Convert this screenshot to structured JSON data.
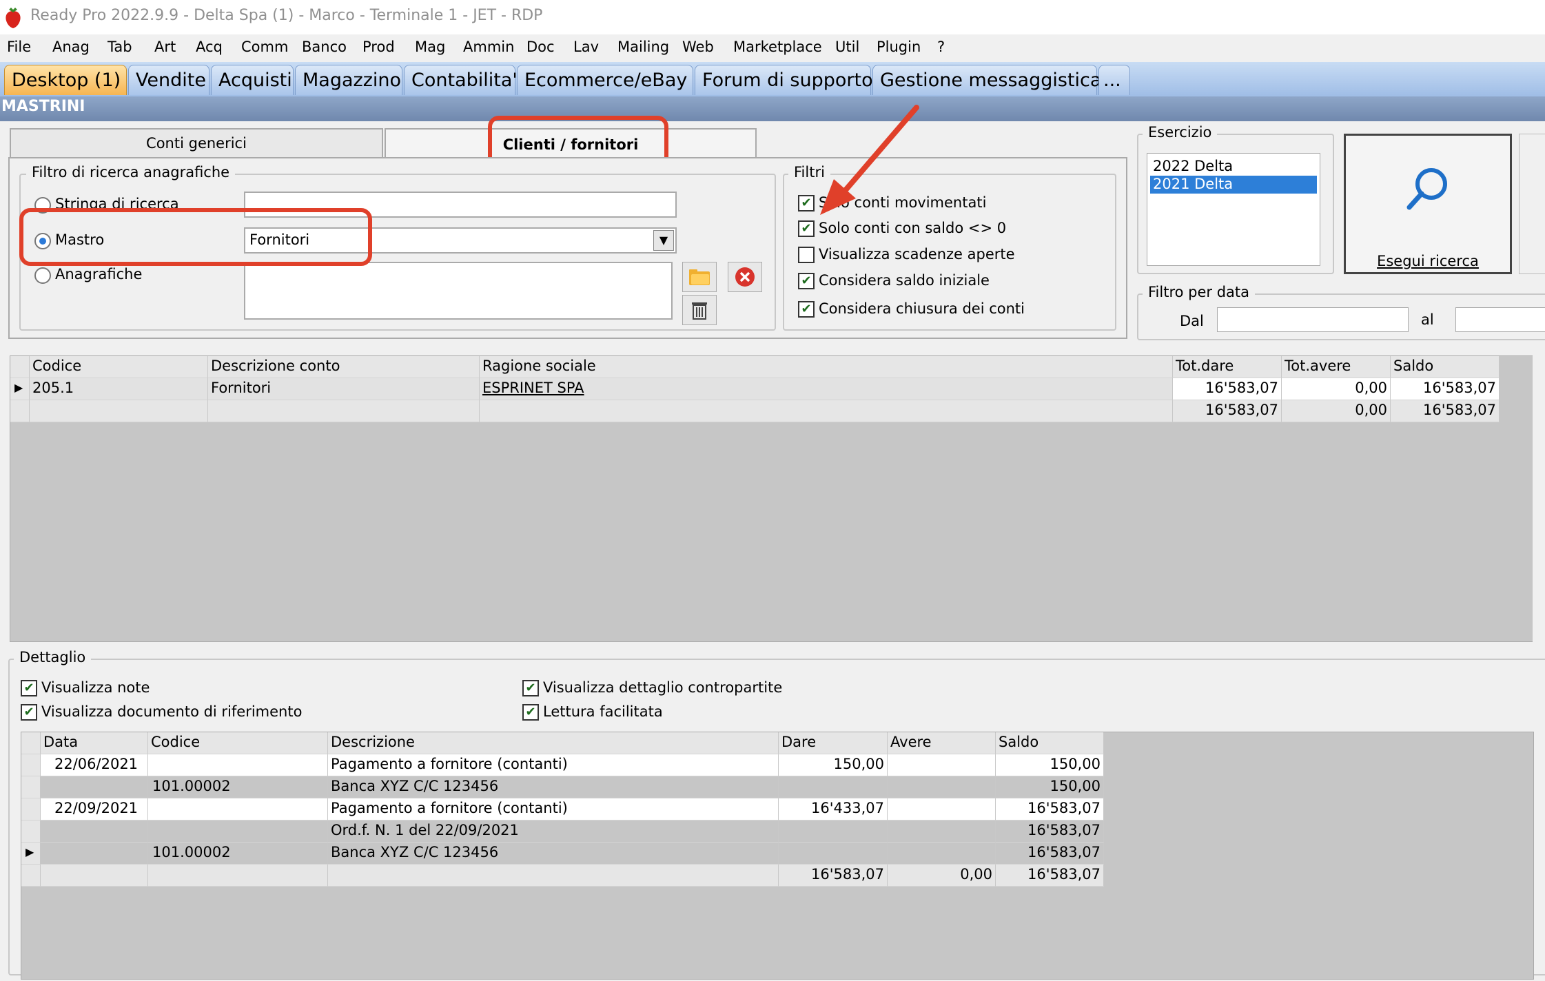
{
  "window": {
    "title": "Ready Pro 2022.9.9 - Delta Spa (1) - Marco - Terminale 1 - JET - RDP"
  },
  "menu": [
    "File",
    "Anag",
    "Tab",
    "Art",
    "Acq",
    "Comm",
    "Banco",
    "Prod",
    "Mag",
    "Ammin",
    "Doc",
    "Lav",
    "Mailing",
    "Web",
    "Marketplace",
    "Util",
    "Plugin",
    "?"
  ],
  "app_tabs": [
    "Desktop (1)",
    "Vendite",
    "Acquisti",
    "Magazzino",
    "Contabilita'",
    "Ecommerce/eBay",
    "Forum di supporto",
    "Gestione messaggistica",
    "..."
  ],
  "section_title": "MASTRINI",
  "inner_tabs": {
    "tab1": "Conti generici",
    "tab2": "Clienti / fornitori"
  },
  "filtro": {
    "legend": "Filtro di ricerca anagrafiche",
    "opt1": "Stringa di ricerca",
    "opt2": "Mastro",
    "opt3": "Anagrafiche",
    "mastro_value": "Fornitori"
  },
  "filtri": {
    "legend": "Filtri",
    "items": [
      "Solo conti movimentati",
      "Solo conti con saldo <> 0",
      "Visualizza scadenze aperte",
      "Considera saldo iniziale",
      "Considera chiusura dei conti"
    ],
    "checked": [
      true,
      true,
      false,
      true,
      true
    ]
  },
  "esercizio": {
    "legend": "Esercizio",
    "items": [
      "2022 Delta",
      "2021 Delta"
    ],
    "selected": 1
  },
  "search_button": "Esegui ricerca",
  "filtro_data": {
    "legend": "Filtro per data",
    "dal": "Dal",
    "al": "al"
  },
  "top_grid": {
    "headers": [
      "Codice",
      "Descrizione conto",
      "Ragione sociale",
      "Tot.dare",
      "Tot.avere",
      "Saldo"
    ],
    "rows": [
      [
        "205.1",
        "Fornitori",
        "ESPRINET SPA",
        "16'583,07",
        "0,00",
        "16'583,07"
      ],
      [
        "",
        "",
        "",
        "16'583,07",
        "0,00",
        "16'583,07"
      ]
    ]
  },
  "dettaglio": {
    "legend": "Dettaglio",
    "opt_note": "Visualizza note",
    "opt_doc": "Visualizza documento di riferimento",
    "opt_contro": "Visualizza dettaglio contropartite",
    "opt_lettura": "Lettura facilitata"
  },
  "detail_grid": {
    "headers": [
      "Data",
      "Codice",
      "Descrizione",
      "Dare",
      "Avere",
      "Saldo"
    ],
    "rows": [
      [
        "22/06/2021",
        "",
        "Pagamento a fornitore (contanti)",
        "150,00",
        "",
        "150,00"
      ],
      [
        "",
        "101.00002",
        "Banca XYZ C/C 123456",
        "",
        "",
        "150,00"
      ],
      [
        "22/09/2021",
        "",
        "Pagamento a fornitore (contanti)",
        "16'433,07",
        "",
        "16'583,07"
      ],
      [
        "",
        "",
        "Ord.f. N. 1 del 22/09/2021",
        "",
        "",
        "16'583,07"
      ],
      [
        "",
        "101.00002",
        "Banca XYZ C/C 123456",
        "",
        "",
        "16'583,07"
      ],
      [
        "",
        "",
        "",
        "16'583,07",
        "0,00",
        "16'583,07"
      ]
    ]
  }
}
